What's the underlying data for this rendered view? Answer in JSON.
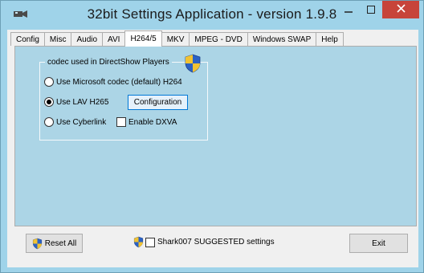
{
  "window": {
    "title": "32bit Settings Application - version 1.9.8",
    "close_glyph": "✕",
    "minimize_glyph": "—",
    "maximize_glyph": "▢",
    "accent_close": "#c7443a",
    "frame_color": "#9fd3e9",
    "panel_color": "#acd5e6"
  },
  "tabs": [
    {
      "label": "Config",
      "active": false
    },
    {
      "label": "Misc",
      "active": false
    },
    {
      "label": "Audio",
      "active": false
    },
    {
      "label": "AVI",
      "active": false
    },
    {
      "label": "H264/5",
      "active": true
    },
    {
      "label": "MKV",
      "active": false
    },
    {
      "label": "MPEG - DVD",
      "active": false
    },
    {
      "label": "Windows SWAP",
      "active": false
    },
    {
      "label": "Help",
      "active": false
    }
  ],
  "codec_group": {
    "title": "codec used in DirectShow Players",
    "options": [
      {
        "label": "Use Microsoft codec (default) H264",
        "selected": false
      },
      {
        "label": "Use LAV H265",
        "selected": true
      },
      {
        "label": "Use Cyberlink",
        "selected": false
      }
    ],
    "configuration_label": "Configuration",
    "dxva_label": "Enable DXVA",
    "dxva_checked": false
  },
  "footer": {
    "reset_label": "Reset All",
    "suggested_label": "Shark007 SUGGESTED settings",
    "suggested_checked": false,
    "exit_label": "Exit"
  },
  "icons": {
    "app": "video-camera-icon",
    "uac": "uac-shield-icon"
  }
}
